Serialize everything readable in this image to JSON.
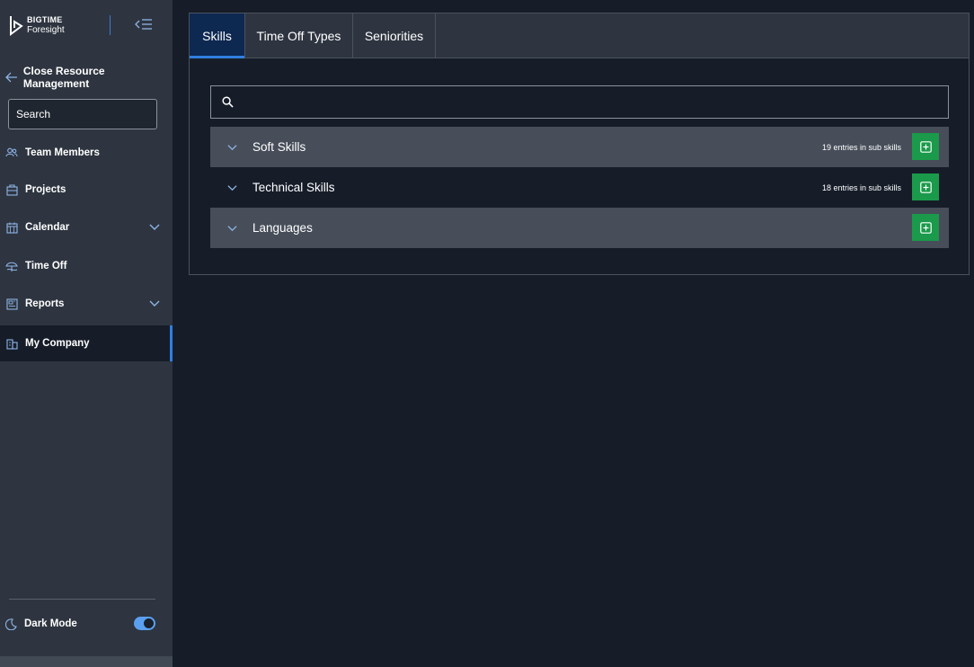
{
  "sidebar": {
    "logo": {
      "brand": "BIGTIME",
      "product": "Foresight"
    },
    "back_label": "Close Resource Management",
    "search_placeholder": "Search",
    "nav": [
      {
        "label": "Team Members",
        "icon": "team-icon"
      },
      {
        "label": "Projects",
        "icon": "projects-icon"
      },
      {
        "label": "Calendar",
        "icon": "calendar-icon",
        "expandable": true
      },
      {
        "label": "Time Off",
        "icon": "time-off-icon"
      },
      {
        "label": "Reports",
        "icon": "reports-icon",
        "expandable": true
      },
      {
        "label": "My Company",
        "icon": "company-icon",
        "active": true
      }
    ],
    "dark_mode_label": "Dark Mode",
    "dark_mode_on": true
  },
  "tabs": [
    {
      "label": "Skills",
      "active": true
    },
    {
      "label": "Time Off Types"
    },
    {
      "label": "Seniorities"
    }
  ],
  "skills": [
    {
      "name": "Soft Skills",
      "count_text": "19 entries in sub skills"
    },
    {
      "name": "Technical Skills",
      "count_text": "18 entries in sub skills"
    },
    {
      "name": "Languages",
      "count_text": ""
    }
  ],
  "colors": {
    "accent": "#2f7fe0",
    "add_button": "#1a9a4a",
    "sidebar_bg": "#2e3540",
    "page_bg": "#161d29"
  }
}
